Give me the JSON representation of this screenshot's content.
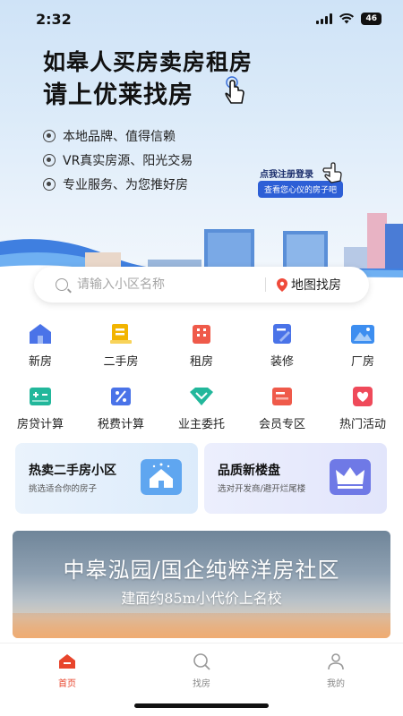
{
  "status": {
    "time": "2:32",
    "battery": "46"
  },
  "hero": {
    "title_line1": "如皋人买房卖房租房",
    "title_line2": "请上优莱找房",
    "features": [
      {
        "icon": "medal-icon",
        "text": "本地品牌、值得信赖"
      },
      {
        "icon": "vr-icon",
        "text": "VR真实房源、阳光交易"
      },
      {
        "icon": "service-icon",
        "text": "专业服务、为您推好房"
      }
    ],
    "register_text": "点我注册登录",
    "register_sub": "查看您心仪的房子吧"
  },
  "search": {
    "placeholder": "请输入小区名称",
    "map_label": "地图找房"
  },
  "categories": [
    {
      "label": "新房",
      "icon": "new-house-icon",
      "color": "#4a73e8"
    },
    {
      "label": "二手房",
      "icon": "second-hand-icon",
      "color": "#f2b400"
    },
    {
      "label": "租房",
      "icon": "rent-icon",
      "color": "#ef5a4a"
    },
    {
      "label": "装修",
      "icon": "decorate-icon",
      "color": "#4a73e8"
    },
    {
      "label": "厂房",
      "icon": "factory-icon",
      "color": "#3d8ef0"
    },
    {
      "label": "房贷计算",
      "icon": "loan-calc-icon",
      "color": "#22b79b"
    },
    {
      "label": "税费计算",
      "icon": "tax-calc-icon",
      "color": "#4a73e8"
    },
    {
      "label": "业主委托",
      "icon": "owner-entrust-icon",
      "color": "#22b79b"
    },
    {
      "label": "会员专区",
      "icon": "member-icon",
      "color": "#ef5a4a"
    },
    {
      "label": "热门活动",
      "icon": "hot-event-icon",
      "color": "#ef4a5a"
    }
  ],
  "cards": [
    {
      "title": "热卖二手房小区",
      "subtitle": "挑选适合你的房子",
      "icon": "house-badge-icon"
    },
    {
      "title": "品质新楼盘",
      "subtitle": "选对开发商/避开烂尾楼",
      "icon": "crown-icon"
    }
  ],
  "promo": {
    "title": "中皋泓园/国企纯粹洋房社区",
    "subtitle": "建面约85m小代价上名校"
  },
  "tabs": [
    {
      "label": "首页",
      "icon": "home-icon",
      "active": true
    },
    {
      "label": "找房",
      "icon": "find-house-icon",
      "active": false
    },
    {
      "label": "我的",
      "icon": "profile-icon",
      "active": false
    }
  ],
  "colors": {
    "accent": "#e8452c",
    "primary_blue": "#2d5fd6"
  }
}
